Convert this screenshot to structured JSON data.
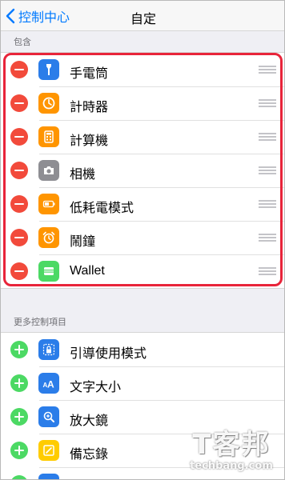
{
  "nav": {
    "back_label": "控制中心",
    "title": "自定"
  },
  "included": {
    "header": "包含",
    "items": [
      {
        "label": "手電筒",
        "icon": "flashlight-icon",
        "color": "#2b7de9"
      },
      {
        "label": "計時器",
        "icon": "timer-icon",
        "color": "#ff9500"
      },
      {
        "label": "計算機",
        "icon": "calculator-icon",
        "color": "#ff9500"
      },
      {
        "label": "相機",
        "icon": "camera-icon",
        "color": "#8e8e93"
      },
      {
        "label": "低耗電模式",
        "icon": "battery-icon",
        "color": "#ff9500"
      },
      {
        "label": "鬧鐘",
        "icon": "alarm-clock-icon",
        "color": "#ff9500"
      },
      {
        "label": "Wallet",
        "icon": "wallet-icon",
        "color": "#4cd964"
      }
    ]
  },
  "more": {
    "header": "更多控制項目",
    "items": [
      {
        "label": "引導使用模式",
        "icon": "guided-access-icon",
        "color": "#2b7de9"
      },
      {
        "label": "文字大小",
        "icon": "text-size-icon",
        "color": "#2b7de9"
      },
      {
        "label": "放大鏡",
        "icon": "magnifier-icon",
        "color": "#2b7de9"
      },
      {
        "label": "備忘錄",
        "icon": "notes-icon",
        "color": "#ffcc00"
      }
    ]
  },
  "watermark": {
    "logo": "T客邦",
    "site": "techbang.com"
  },
  "colors": {
    "accent": "#007aff",
    "remove": "#f24a3b",
    "add": "#4cd964",
    "highlight": "#e8243a"
  }
}
